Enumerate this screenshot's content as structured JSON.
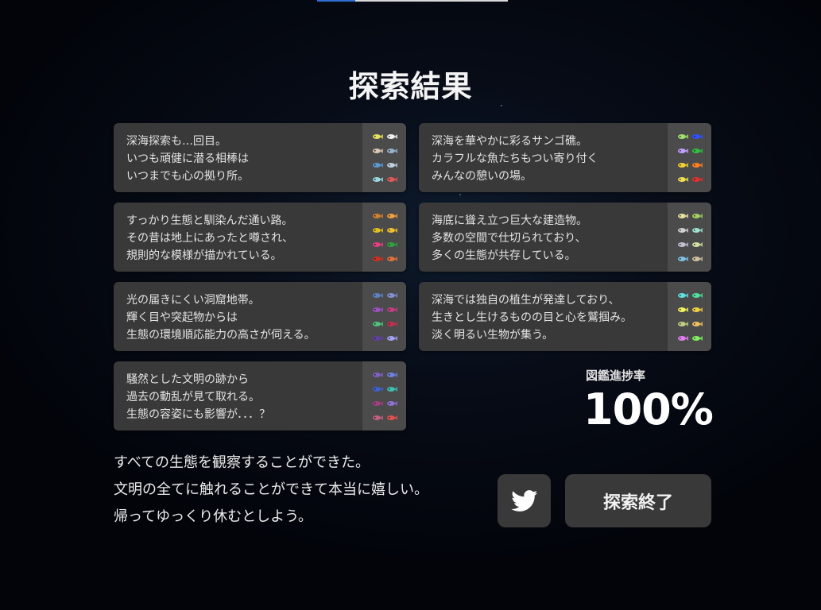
{
  "screen": {
    "title": "探索結果",
    "progress_label": "図鑑進捗率",
    "progress_value": "100%",
    "progress_fraction": 1.0
  },
  "loading_bar": {
    "fill_fraction": 0.2,
    "fill_color": "#2f6fd6",
    "track_color": "#d8d8d8"
  },
  "areas": [
    {
      "lines": [
        "深海探索も…回目。",
        "いつも頑健に潜る相棒は",
        "いつまでも心の拠り所。"
      ],
      "creature_colors": [
        "#e8e060",
        "#f0f0f0",
        "#d8c8b0",
        "#9ab0c8",
        "#5a9ad0",
        "#c0d0e0",
        "#9ad8e0",
        "#e05858"
      ]
    },
    {
      "lines": [
        "深海を華やかに彩るサンゴ礁。",
        "カラフルな魚たちもつい寄り付く",
        "みんなの憩いの場。"
      ],
      "creature_colors": [
        "#a0e070",
        "#3050ff",
        "#c0a0ff",
        "#30c040",
        "#f0d030",
        "#ff8020",
        "#f0e050",
        "#e03030"
      ]
    },
    {
      "lines": [
        "すっかり生態と馴染んだ通い路。",
        "その昔は地上にあったと噂され、",
        "規則的な模様が描かれている。"
      ],
      "creature_colors": [
        "#d08030",
        "#f0a040",
        "#e0c020",
        "#f0c030",
        "#e04080",
        "#30a040",
        "#d03020",
        "#e07040"
      ]
    },
    {
      "lines": [
        "海底に聳え立つ巨大な建造物。",
        "多数の空間で仕切られており、",
        "多くの生態が共存している。"
      ],
      "creature_colors": [
        "#e8e0a0",
        "#a0d060",
        "#d0d0d0",
        "#a0e0d0",
        "#c0c0d0",
        "#d0e0a0",
        "#80c0e0",
        "#d0c0a0"
      ]
    },
    {
      "lines": [
        "光の届きにくい洞窟地帯。",
        "輝く目や突起物からは",
        "生態の環境順応能力の高さが伺える。"
      ],
      "creature_colors": [
        "#6080c0",
        "#8090d0",
        "#a050c0",
        "#c04080",
        "#50c080",
        "#c03050",
        "#6040a0",
        "#a0a0f0"
      ]
    },
    {
      "lines": [
        "深海では独自の植生が発達しており、",
        "生きとし生けるものの目と心を鷲掴み。",
        "淡く明るい生物が集う。"
      ],
      "creature_colors": [
        "#60e0e0",
        "#50e0a0",
        "#f0f060",
        "#f0d040",
        "#c0d080",
        "#f0c060",
        "#e080f0",
        "#80f060"
      ]
    },
    {
      "lines": [
        "騒然とした文明の跡から",
        "過去の動乱が見て取れる。",
        "生態の容姿にも影響が．．．？"
      ],
      "creature_colors": [
        "#8060c0",
        "#7080e0",
        "#4060d0",
        "#40c0b0",
        "#a04080",
        "#9070d0",
        "#c06080",
        "#e05050"
      ]
    }
  ],
  "message": {
    "lines": [
      "すべての生態を観察することができた。",
      "文明の全てに触れることができて本当に嬉しい。",
      "帰ってゆっくり休むとしよう。"
    ]
  },
  "buttons": {
    "share_icon": "twitter-icon",
    "end_label": "探索終了"
  }
}
